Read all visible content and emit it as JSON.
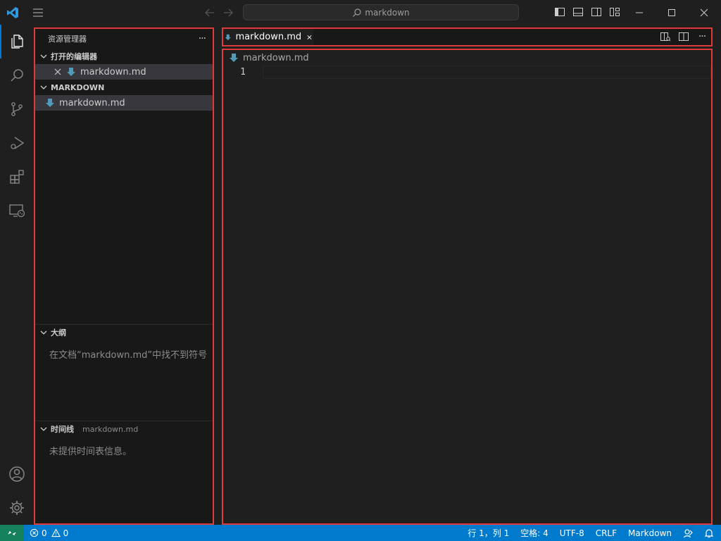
{
  "titlebar": {
    "search_text": "markdown"
  },
  "sidebar": {
    "title": "资源管理器",
    "more": "···",
    "open_editors": {
      "label": "打开的编辑器",
      "items": [
        {
          "label": "markdown.md"
        }
      ]
    },
    "folder": {
      "label": "MARKDOWN",
      "items": [
        {
          "label": "markdown.md"
        }
      ]
    },
    "outline": {
      "label": "大纲",
      "message": "在文档“markdown.md”中找不到符号"
    },
    "timeline": {
      "label": "时间线",
      "file": "markdown.md",
      "message": "未提供时间表信息。"
    }
  },
  "editor": {
    "tab_label": "markdown.md",
    "breadcrumb": "markdown.md",
    "line_numbers": [
      "1"
    ],
    "tab_more": "···"
  },
  "statusbar": {
    "errors": "0",
    "warnings": "0",
    "position": "行 1，列 1",
    "spaces": "空格: 4",
    "encoding": "UTF-8",
    "eol": "CRLF",
    "language": "Markdown"
  },
  "colors": {
    "accent": "#007acc",
    "remote": "#16825d",
    "highlight_box": "#e03a3a",
    "md_icon": "#519aba"
  }
}
